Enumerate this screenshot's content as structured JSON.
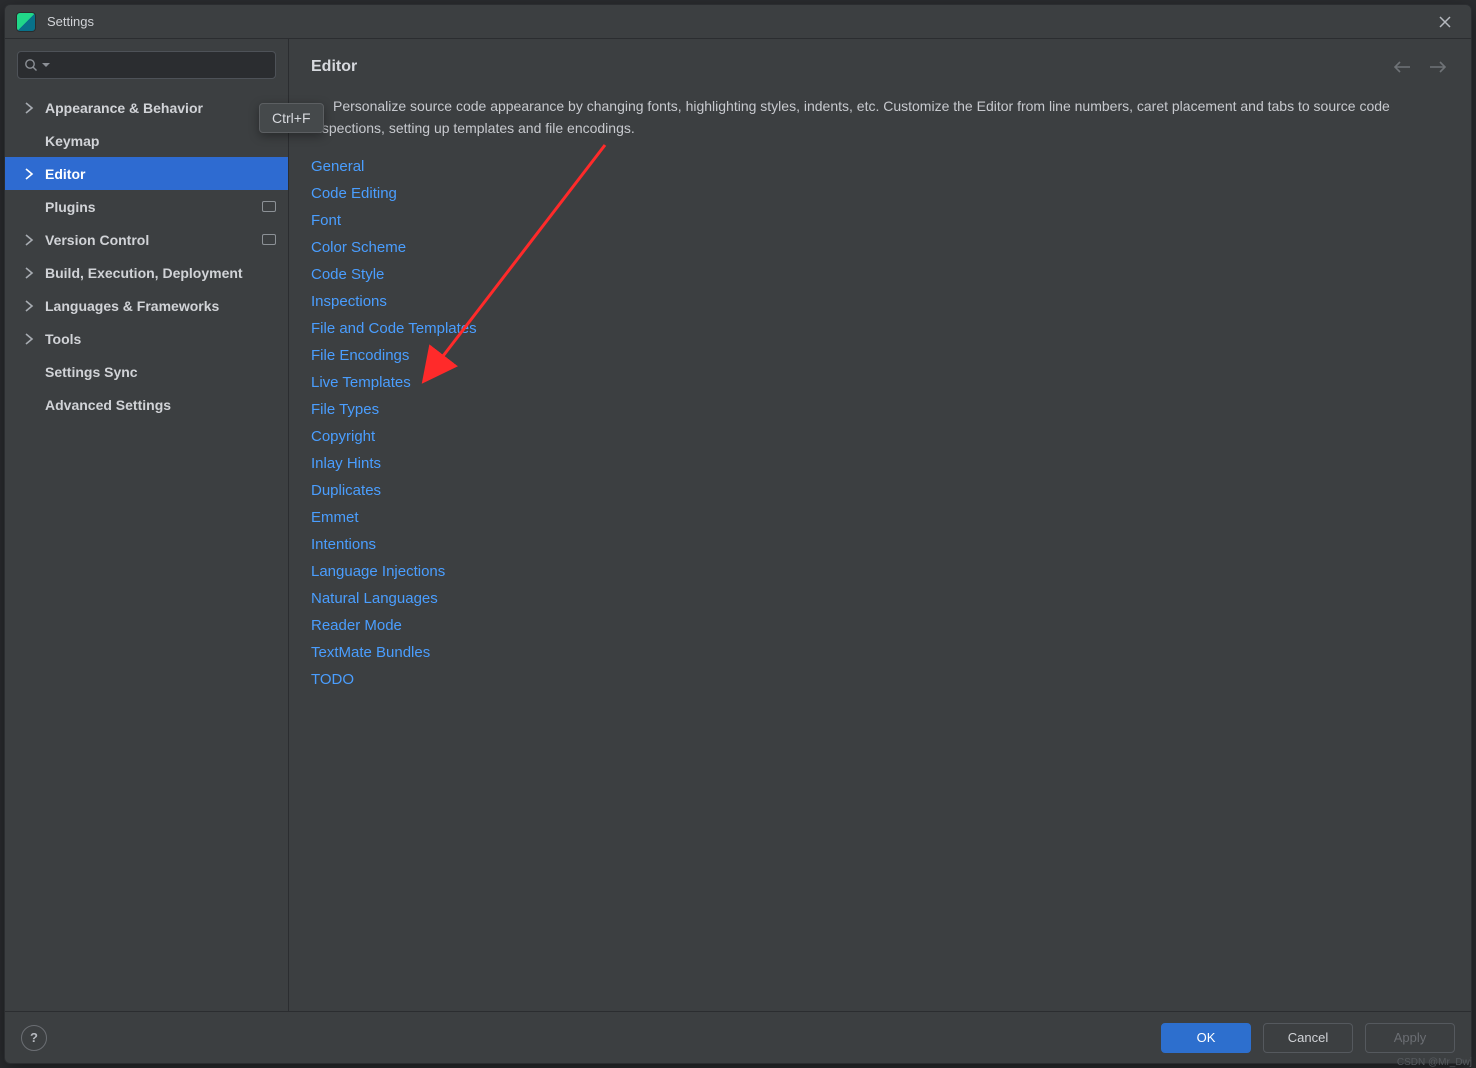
{
  "window": {
    "title": "Settings"
  },
  "search": {
    "placeholder": ""
  },
  "tooltip": {
    "text": "Ctrl+F"
  },
  "sidebar": {
    "items": [
      {
        "label": "Appearance & Behavior",
        "expandable": true,
        "selected": false,
        "badge": false
      },
      {
        "label": "Keymap",
        "expandable": false,
        "selected": false,
        "badge": false
      },
      {
        "label": "Editor",
        "expandable": true,
        "selected": true,
        "badge": false
      },
      {
        "label": "Plugins",
        "expandable": false,
        "selected": false,
        "badge": true
      },
      {
        "label": "Version Control",
        "expandable": true,
        "selected": false,
        "badge": true
      },
      {
        "label": "Build, Execution, Deployment",
        "expandable": true,
        "selected": false,
        "badge": false
      },
      {
        "label": "Languages & Frameworks",
        "expandable": true,
        "selected": false,
        "badge": false
      },
      {
        "label": "Tools",
        "expandable": true,
        "selected": false,
        "badge": false
      },
      {
        "label": "Settings Sync",
        "expandable": false,
        "selected": false,
        "badge": false
      },
      {
        "label": "Advanced Settings",
        "expandable": false,
        "selected": false,
        "badge": false
      }
    ]
  },
  "content": {
    "title": "Editor",
    "description": "Personalize source code appearance by changing fonts, highlighting styles, indents, etc. Customize the Editor from line numbers, caret placement and tabs to source code inspections, setting up templates and file encodings.",
    "links": [
      "General",
      "Code Editing",
      "Font",
      "Color Scheme",
      "Code Style",
      "Inspections",
      "File and Code Templates",
      "File Encodings",
      "Live Templates",
      "File Types",
      "Copyright",
      "Inlay Hints",
      "Duplicates",
      "Emmet",
      "Intentions",
      "Language Injections",
      "Natural Languages",
      "Reader Mode",
      "TextMate Bundles",
      "TODO"
    ]
  },
  "footer": {
    "ok": "OK",
    "cancel": "Cancel",
    "apply": "Apply"
  },
  "watermark": "CSDN @Mr_Dwj"
}
